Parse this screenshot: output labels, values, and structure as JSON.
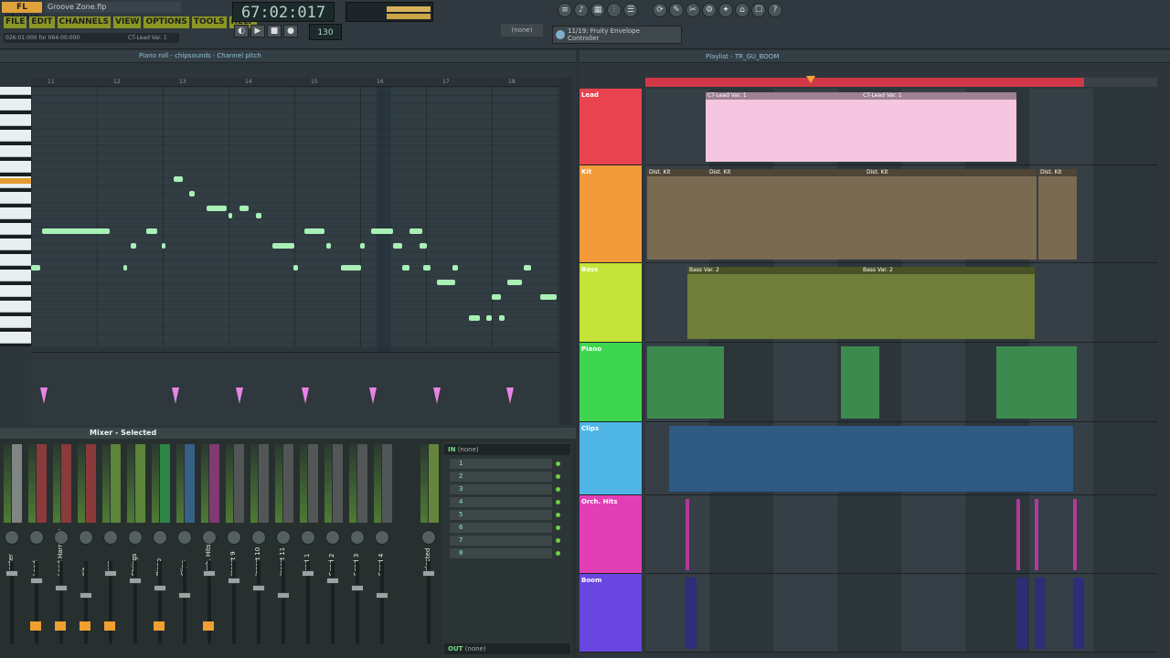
{
  "app": {
    "logo": "FL STUDIO",
    "project": "Groove Zone.flp"
  },
  "menu": [
    "FILE",
    "EDIT",
    "CHANNELS",
    "VIEW",
    "OPTIONS",
    "TOOLS",
    "HELP"
  ],
  "hint": {
    "left": "026:01:000 for 064:00:000",
    "right": "CT-Lead Var. 1"
  },
  "transport": {
    "time": "67:02:017",
    "tempo": "130",
    "snap": "(none)"
  },
  "plugin": {
    "line1": "11/19: Fruity Envelope",
    "line2": "Controller"
  },
  "piano_roll": {
    "title": "Piano roll - chipsounds",
    "target": "Channel pitch",
    "ruler": [
      "11",
      "12",
      "13",
      "14",
      "15",
      "16",
      "17",
      "18"
    ]
  },
  "mixer": {
    "title": "Mixer - Selected",
    "strips": [
      "Master",
      "Lead",
      "Lead Harmony",
      "Kit",
      "Bass",
      "Strings",
      "Piano",
      "Clips",
      "Orch. Hits",
      "Insert 9",
      "Insert 10",
      "Insert 11",
      "Send 1",
      "Send 2",
      "Send 3",
      "Send 4",
      "Selected"
    ],
    "slots": [
      "1",
      "2",
      "3",
      "4",
      "5",
      "6",
      "7",
      "8"
    ],
    "in": "(none)",
    "out": "(none)",
    "in_label": "IN",
    "out_label": "OUT"
  },
  "playlist": {
    "title": "Playlist - TR_GU_BOOM",
    "tracks": [
      {
        "name": "Lead",
        "color": "#e8434f"
      },
      {
        "name": "Kit",
        "color": "#f39a3a"
      },
      {
        "name": "Bass",
        "color": "#c4e43a"
      },
      {
        "name": "Piano",
        "color": "#3ed64f"
      },
      {
        "name": "Clips",
        "color": "#4fb4e6"
      },
      {
        "name": "Orch. Hits",
        "color": "#e23fb6"
      },
      {
        "name": "Boom",
        "color": "#6a46e0"
      }
    ],
    "clips": {
      "lead": "CT-Lead Var. 1",
      "kit": "Dist. Kit",
      "bass": "Bass Var. 2"
    }
  }
}
